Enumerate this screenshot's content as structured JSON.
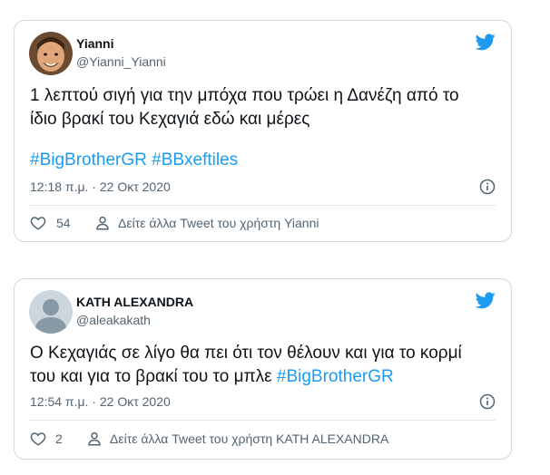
{
  "tweets": [
    {
      "display_name": "Yianni",
      "handle": "@Yianni_Yianni",
      "text_line1": "1 λεπτού σιγή για την μπόχα που τρώει η Δανέζη από το",
      "text_line2": "ίδιο βρακί του Κεχαγιά εδώ και μέρες",
      "hashtag1": "#BigBrotherGR",
      "hashtag2": "#BBxeftiles",
      "timestamp": "12:18 π.μ. · 22 Οκτ 2020",
      "like_count": "54",
      "more_tweets_label": "Δείτε άλλα Tweet του χρήστη Yianni"
    },
    {
      "display_name": "KATH ALEXANDRA",
      "handle": "@aleakakath",
      "text_line1": "Ο Κεχαγιάς σε λίγο θα πει ότι τον θέλουν και για το κορμί",
      "text_line2": "του και για το βρακί του το μπλε",
      "hashtag1": "#BigBrotherGR",
      "timestamp": "12:54 π.μ. · 22 Οκτ 2020",
      "like_count": "2",
      "more_tweets_label": "Δείτε άλλα Tweet του χρήστη KATH ALEXANDRA"
    }
  ],
  "colors": {
    "hashtag": "#1d9bf0",
    "twitter_bird": "#1d9bf0",
    "secondary_text": "#536471",
    "border": "#cfd9de"
  },
  "icons": [
    "twitter-bird-icon",
    "info-icon",
    "heart-icon",
    "person-icon"
  ]
}
